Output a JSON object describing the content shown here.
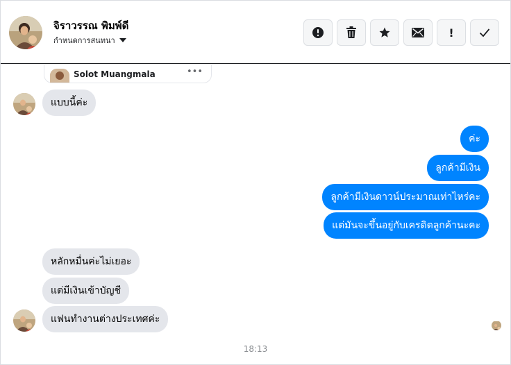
{
  "header": {
    "title": "จิราวรรณ พิมพ์ดี",
    "subtitle": "กำหนดการสนทนา",
    "actions": [
      {
        "name": "block",
        "icon": "alert-circle-icon"
      },
      {
        "name": "delete",
        "icon": "trash-icon"
      },
      {
        "name": "star",
        "icon": "star-icon"
      },
      {
        "name": "mark-unread",
        "icon": "envelope-icon"
      },
      {
        "name": "spam",
        "icon": "exclamation-icon",
        "glyph": "!"
      },
      {
        "name": "done",
        "icon": "checkmark-icon"
      }
    ]
  },
  "attachment": {
    "name": "Solot Muangmala",
    "more": "•••"
  },
  "messages": {
    "m1": "แบบนี้ค่ะ",
    "m2": "ค่ะ",
    "m3": "ลูกค้ามีเงิน",
    "m4": "ลูกค้ามีเงินดาวน์ประมาณเท่าไหร่คะ",
    "m5": "แต่มันจะขึ้นอยู่กับเครดิตลูกค้านะคะ",
    "m6": "หลักหมื่นค่ะไม่เยอะ",
    "m7": "แต่มีเงินเข้าบัญชี",
    "m8": "แฟนทำงานต่างประเทศค่ะ"
  },
  "timestamp": "18:13",
  "colors": {
    "outgoing_bubble": "#0084ff",
    "incoming_bubble": "#e4e6eb",
    "button_bg": "#f5f6f7"
  }
}
